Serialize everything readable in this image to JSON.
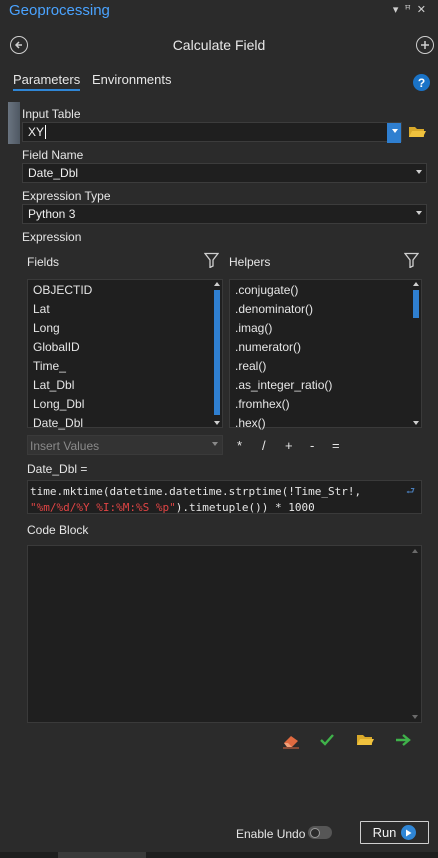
{
  "window": {
    "title": "Geoprocessing",
    "controls": "▾ ⊓ ✕"
  },
  "header": {
    "title": "Calculate Field"
  },
  "tabs": [
    {
      "label": "Parameters"
    },
    {
      "label": "Environments"
    }
  ],
  "help": {
    "glyph": "?"
  },
  "input_table": {
    "label": "Input Table",
    "value": "XY"
  },
  "field_name": {
    "label": "Field Name",
    "value": "Date_Dbl"
  },
  "expression_type": {
    "label": "Expression Type",
    "value": "Python 3"
  },
  "expression": {
    "label": "Expression"
  },
  "fields": {
    "label": "Fields",
    "items": [
      "OBJECTID",
      "Lat",
      "Long",
      "GlobalID",
      "Time_",
      "Lat_Dbl",
      "Long_Dbl",
      "Date_Dbl"
    ]
  },
  "helpers": {
    "label": "Helpers",
    "items": [
      ".conjugate()",
      ".denominator()",
      ".imag()",
      ".numerator()",
      ".real()",
      ".as_integer_ratio()",
      ".fromhex()",
      ".hex()"
    ]
  },
  "insert_values": {
    "placeholder": "Insert Values"
  },
  "operators": [
    "*",
    "/",
    "+",
    "-",
    "="
  ],
  "expr_target": {
    "label": "Date_Dbl ="
  },
  "expr_code": {
    "line1": "time.mktime(datetime.datetime.strptime(!Time_Str!,",
    "line2_str": "\"%m/%d/%Y %I:%M:%S %p\"",
    "line2_rest": ").timetuple()) * 1000"
  },
  "code_block": {
    "label": "Code Block"
  },
  "footer": {
    "enable_undo": "Enable Undo",
    "run": "Run"
  },
  "colors": {
    "accent": "#2f86d6",
    "brand_title": "#4aa3ff",
    "string": "#e04545",
    "check": "#3fb24a",
    "folder": "#e3b52b",
    "eraser": "#e06a40"
  }
}
